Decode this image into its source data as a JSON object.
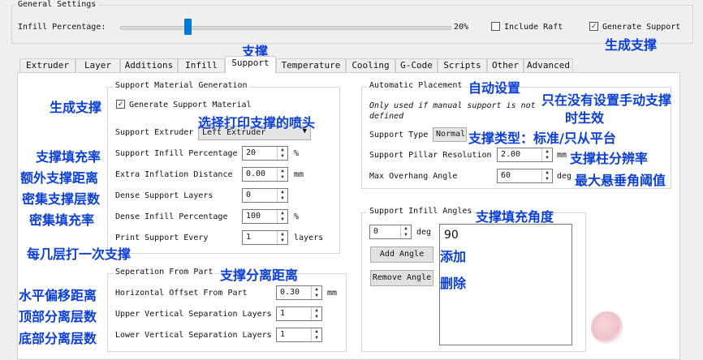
{
  "general": {
    "title": "General Settings",
    "infill_label": "Infill Percentage:",
    "infill_value": "20%",
    "infill_fraction": 0.2,
    "include_raft_label": "Include Raft",
    "include_raft_checked": false,
    "generate_support_label": "Generate Support",
    "generate_support_checked": true
  },
  "tabs": [
    {
      "label": "Extruder"
    },
    {
      "label": "Layer"
    },
    {
      "label": "Additions"
    },
    {
      "label": "Infill"
    },
    {
      "label": "Support",
      "active": true
    },
    {
      "label": "Temperature"
    },
    {
      "label": "Cooling"
    },
    {
      "label": "G-Code"
    },
    {
      "label": "Scripts"
    },
    {
      "label": "Other"
    },
    {
      "label": "Advanced"
    }
  ],
  "support_gen": {
    "title": "Support Material Generation",
    "generate_label": "Generate Support Material",
    "extruder_label": "Support Extruder",
    "extruder_value": "Left Extruder",
    "infill_pct_label": "Support Infill Percentage",
    "infill_pct_value": "20",
    "infill_pct_unit": "%",
    "inflation_label": "Extra Inflation Distance",
    "inflation_value": "0.00",
    "inflation_unit": "mm",
    "dense_layers_label": "Dense Support Layers",
    "dense_layers_value": "0",
    "dense_infill_label": "Dense Infill Percentage",
    "dense_infill_value": "100",
    "dense_infill_unit": "%",
    "print_every_label": "Print Support Every",
    "print_every_value": "1",
    "print_every_unit": "layers"
  },
  "separation": {
    "title": "Seperation From Part",
    "horizontal_label": "Horizontal Offset From Part",
    "horizontal_value": "0.30",
    "horizontal_unit": "mm",
    "upper_label": "Upper Vertical Separation Layers",
    "upper_value": "1",
    "lower_label": "Lower Vertical Separation Layers",
    "lower_value": "1"
  },
  "auto_place": {
    "title": "Automatic Placement",
    "note": "Only used if manual support is not defined",
    "type_label": "Support Type",
    "type_value": "Normal",
    "pillar_label": "Support Pillar Resolution",
    "pillar_value": "2.00",
    "pillar_unit": "mm",
    "overhang_label": "Max Overhang Angle",
    "overhang_value": "60",
    "overhang_unit": "deg"
  },
  "angles": {
    "title": "Support Infill Angles",
    "input_value": "0",
    "input_unit": "deg",
    "add_label": "Add Angle",
    "remove_label": "Remove Angle",
    "list": [
      "90"
    ]
  },
  "annotations": {
    "support": "支撑",
    "generate_support": "生成支撑",
    "generate_support_material": "生成支撑",
    "choose_extruder": "选择打印支撑的喷头",
    "infill_pct": "支撑填充率",
    "inflation": "额外支撑距离",
    "dense_layers": "密集支撑层数",
    "dense_infill": "密集填充率",
    "print_every": "每几层打一次支撑",
    "separation": "支撑分离距离",
    "horizontal": "水平偏移距离",
    "upper": "顶部分离层数",
    "lower": "底部分离层数",
    "auto": "自动设置",
    "manual_only_1": "只在没有设置手动支撑",
    "manual_only_2": "时生效",
    "type": "支撑类型：标准/只从平台",
    "pillar": "支撑柱分辨率",
    "overhang": "最大悬垂角阈值",
    "angles": "支撑填充角度",
    "add": "添加",
    "remove": "删除"
  }
}
